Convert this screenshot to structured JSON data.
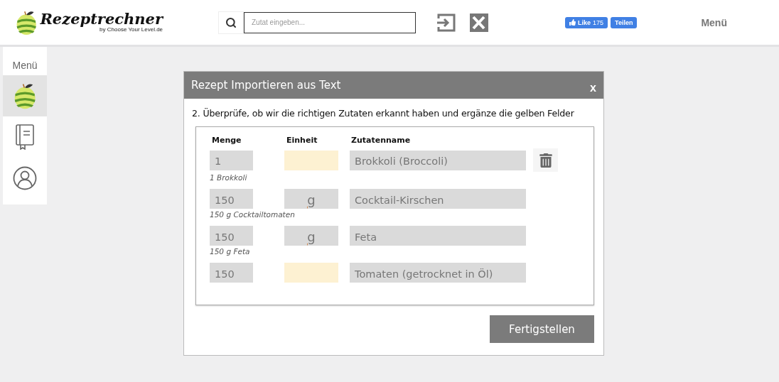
{
  "header": {
    "logo": {
      "title": "Rezeptrechner",
      "subtitle": "by Choose Your Level.de"
    },
    "search": {
      "placeholder": "Zutat eingeben..."
    },
    "like": {
      "label": "Like",
      "count": "175"
    },
    "share": "Teilen",
    "menu": "Menü"
  },
  "sidebar": {
    "title": "Menü",
    "items": [
      {
        "kind": "apple",
        "selected": true
      },
      {
        "kind": "book",
        "selected": false
      },
      {
        "kind": "user",
        "selected": false
      }
    ]
  },
  "dialog": {
    "title": "Rezept Importieren aus Text",
    "close": "x",
    "instruction": "2. Überprüfe, ob wir die richtigen Zutaten erkannt haben und ergänze die gelben Felder",
    "columns": [
      "Menge",
      "Einheit",
      "Zutatenname"
    ],
    "rows": [
      {
        "amount": "1",
        "unit_missing": true,
        "name": "Brokkoli (Broccoli)",
        "original": "1 Brokkoli",
        "deletable": true
      },
      {
        "amount": "150",
        "unit": "g",
        "unit_missing": false,
        "name": "Cocktail-Kirschen",
        "original": "150 g Cocktailtomaten",
        "deletable": false
      },
      {
        "amount": "150",
        "unit": "g",
        "unit_missing": false,
        "name": "Feta",
        "original": "150 g Feta",
        "deletable": false
      },
      {
        "amount": "150",
        "unit_missing": true,
        "name": "Tomaten (getrocknet in Öl)",
        "deletable": false
      }
    ],
    "finish_button": "Fertigstellen"
  }
}
